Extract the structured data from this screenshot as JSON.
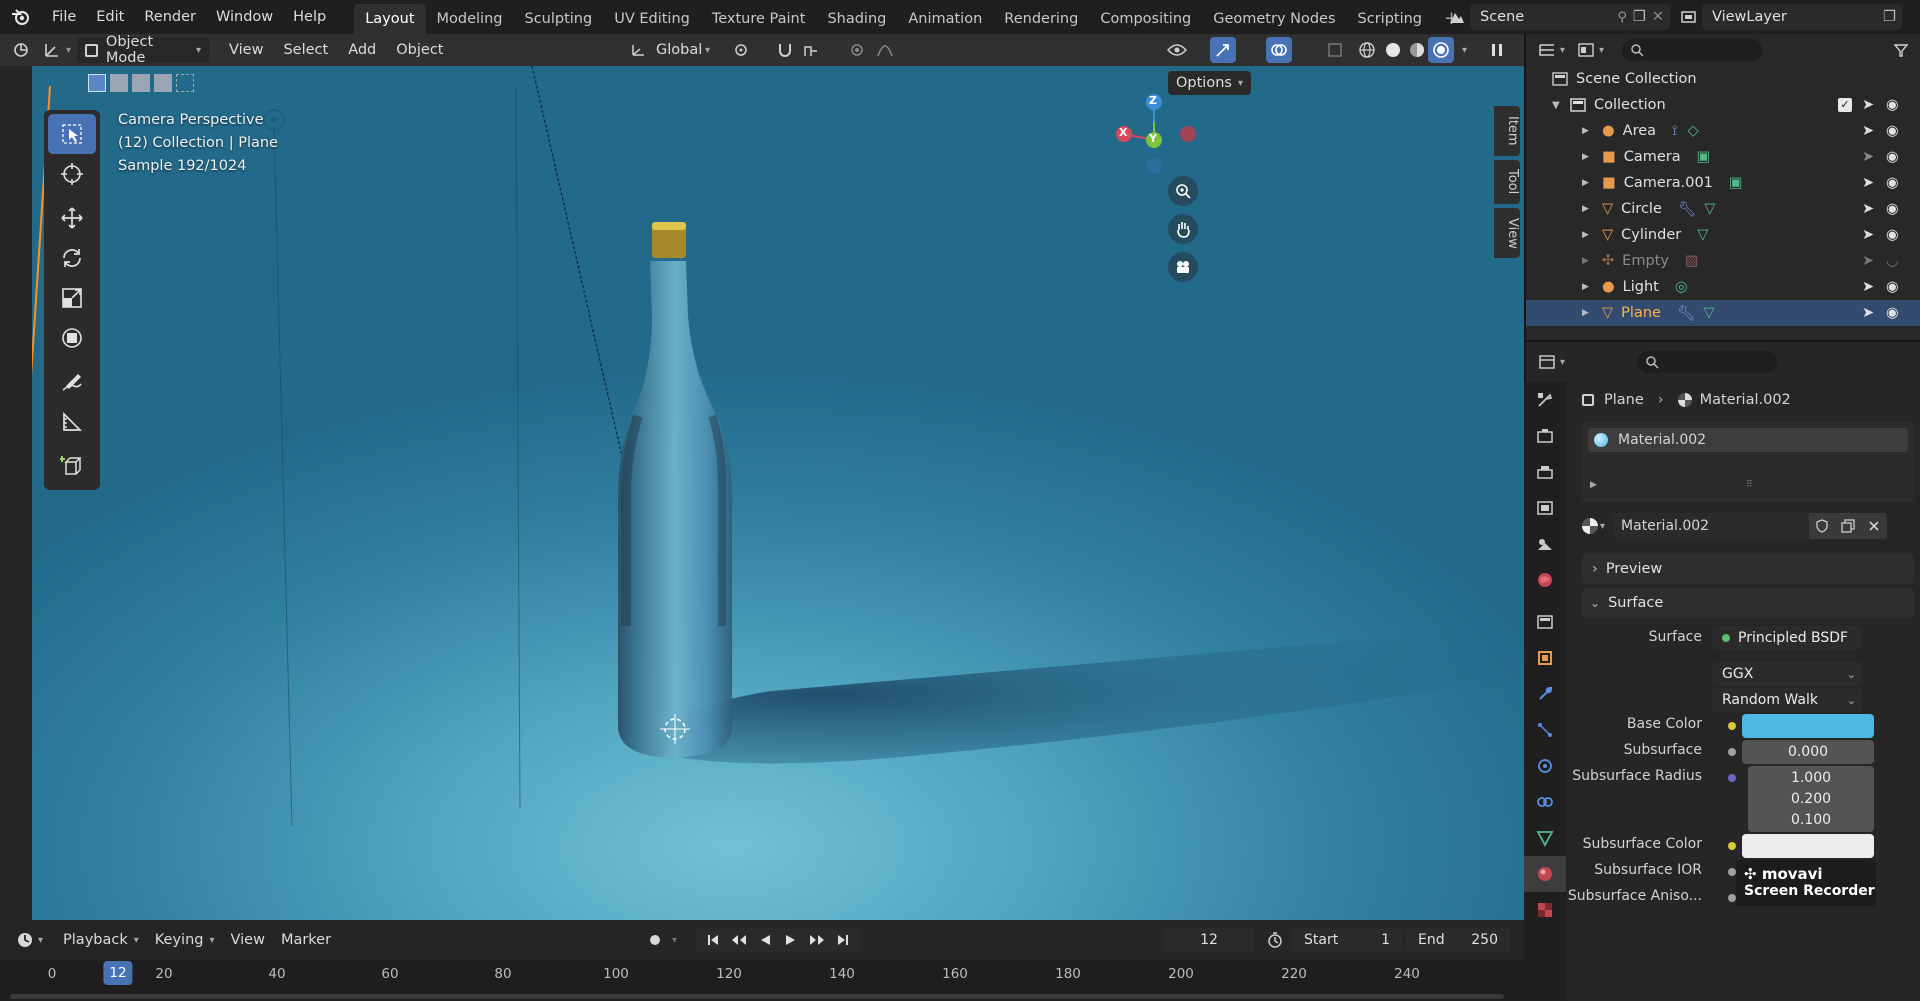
{
  "topbar": {
    "menu": [
      "File",
      "Edit",
      "Render",
      "Window",
      "Help"
    ],
    "workspaces": [
      "Layout",
      "Modeling",
      "Sculpting",
      "UV Editing",
      "Texture Paint",
      "Shading",
      "Animation",
      "Rendering",
      "Compositing",
      "Geometry Nodes",
      "Scripting"
    ],
    "active_workspace": "Layout",
    "scene": "Scene",
    "view_layer": "ViewLayer"
  },
  "viewport_header": {
    "mode": "Object Mode",
    "menus": [
      "View",
      "Select",
      "Add",
      "Object"
    ],
    "orientation": "Global",
    "options": "Options"
  },
  "viewport": {
    "camera_label": "Camera Perspective",
    "collection_label": "(12) Collection | Plane",
    "sample_label": "Sample 192/1024",
    "gizmo": {
      "x": "X",
      "y": "Y",
      "z": "Z"
    },
    "side_tabs": [
      "Item",
      "Tool",
      "View"
    ]
  },
  "timeline": {
    "menus": [
      "Playback",
      "Keying",
      "View",
      "Marker"
    ],
    "current_frame": "12",
    "start_label": "Start",
    "start": "1",
    "end_label": "End",
    "end": "250",
    "ruler": [
      "0",
      "12",
      "20",
      "40",
      "60",
      "80",
      "100",
      "120",
      "140",
      "160",
      "180",
      "200",
      "220",
      "240"
    ]
  },
  "outliner": {
    "scene_collection": "Scene Collection",
    "collection": "Collection",
    "items": [
      {
        "name": "Area",
        "type": "light"
      },
      {
        "name": "Camera",
        "type": "camera"
      },
      {
        "name": "Camera.001",
        "type": "camera"
      },
      {
        "name": "Circle",
        "type": "mesh"
      },
      {
        "name": "Cylinder",
        "type": "mesh"
      },
      {
        "name": "Empty",
        "type": "empty"
      },
      {
        "name": "Light",
        "type": "light"
      },
      {
        "name": "Plane",
        "type": "mesh"
      }
    ],
    "selected": "Plane"
  },
  "properties": {
    "breadcrumb_object": "Plane",
    "breadcrumb_material": "Material.002",
    "slot_name": "Material.002",
    "material_name": "Material.002",
    "preview_label": "Preview",
    "surface_panel": "Surface",
    "surface_label": "Surface",
    "surface_value": "Principled BSDF",
    "distribution": "GGX",
    "subsurface_method": "Random Walk",
    "base_color_label": "Base Color",
    "base_color": "#4bb8e6",
    "subsurface_label": "Subsurface",
    "subsurface_value": "0.000",
    "subsurface_radius_label": "Subsurface Radius",
    "subsurface_radius": [
      "1.000",
      "0.200",
      "0.100"
    ],
    "subsurface_color_label": "Subsurface Color",
    "subsurface_color": "#eeeeee",
    "subsurface_ior_label": "Subsurface IOR",
    "subsurface_aniso_label": "Subsurface Aniso..."
  },
  "watermark": {
    "brand": "movavi",
    "product": "Screen Recorder"
  }
}
